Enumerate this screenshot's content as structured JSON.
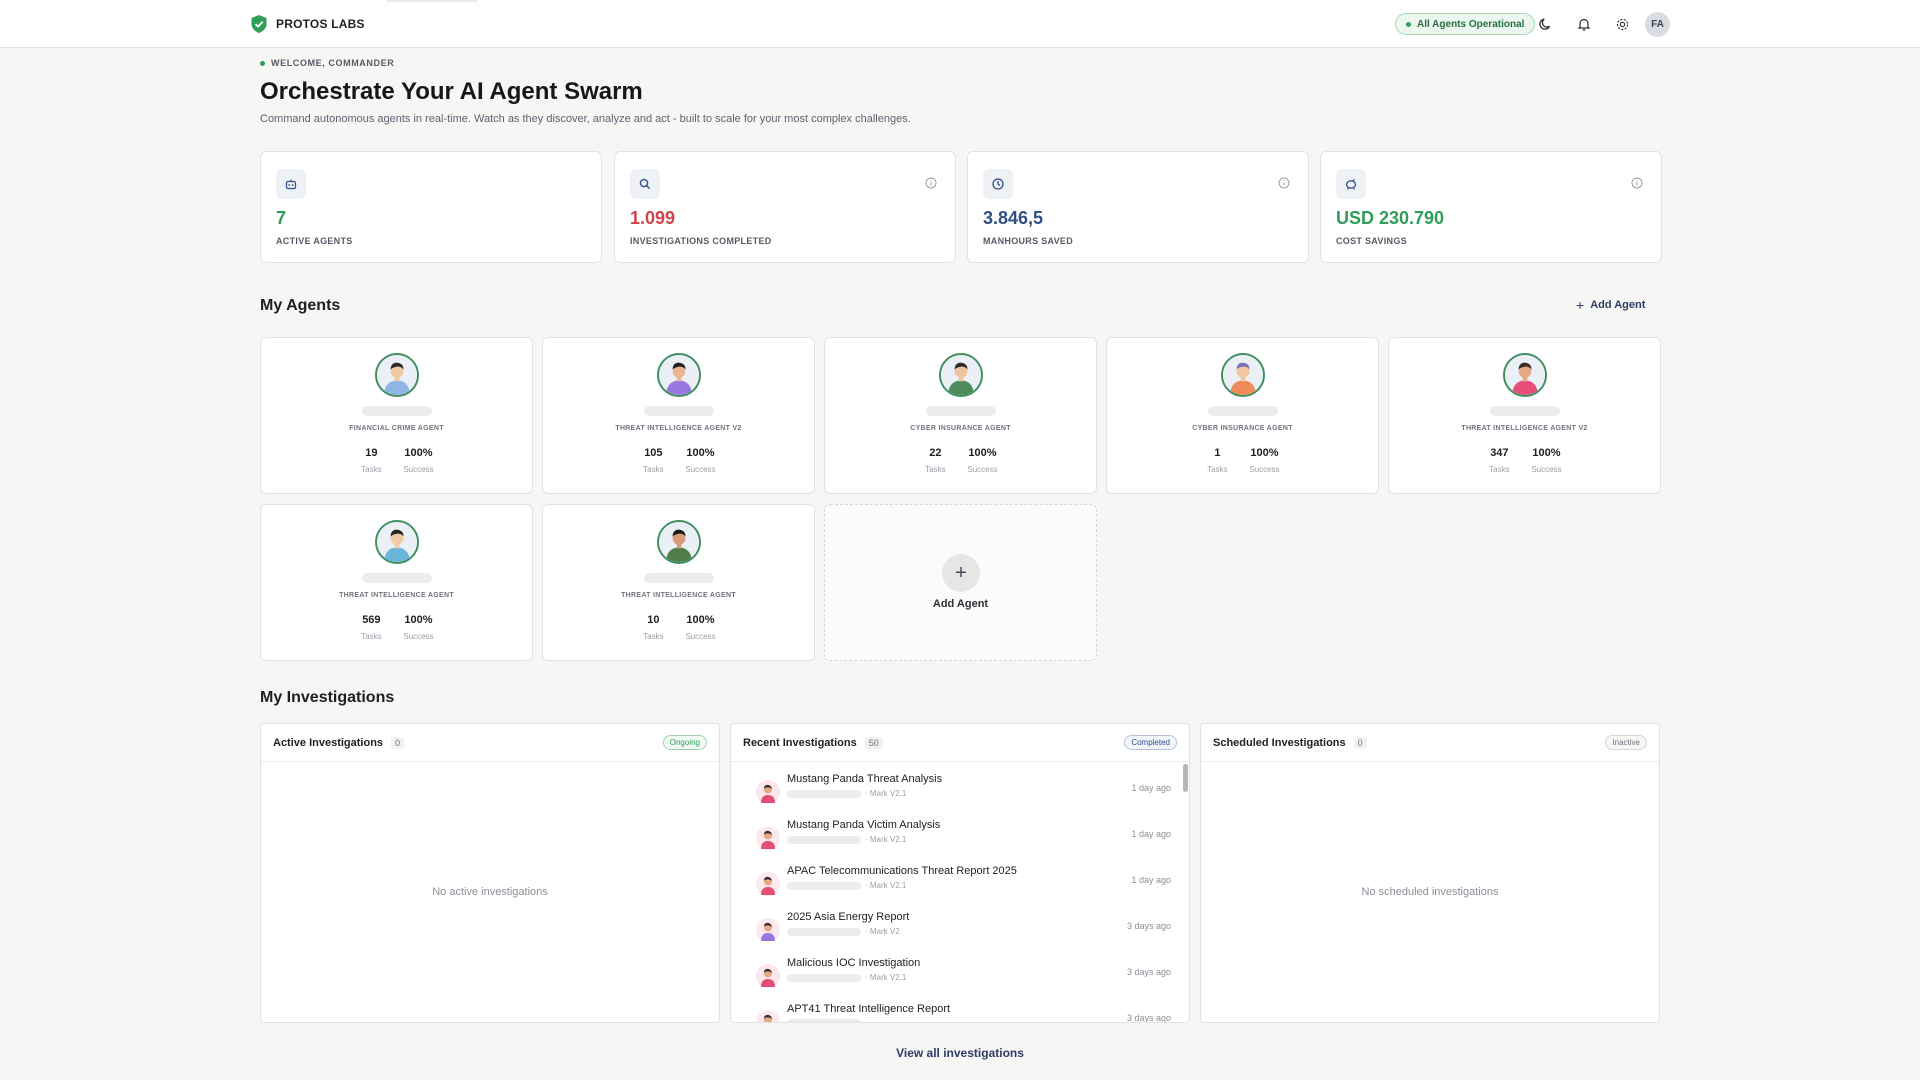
{
  "brand": {
    "name": "PROTOS LABS"
  },
  "topbar": {
    "status": "All Agents Operational",
    "user_initials": "FA"
  },
  "header": {
    "welcome": "WELCOME, COMMANDER",
    "title": "Orchestrate Your AI Agent Swarm",
    "subtitle": "Command autonomous agents in real-time. Watch as they discover, analyze and act - built to scale for your most complex challenges."
  },
  "metrics": [
    {
      "value": "7",
      "label": "ACTIVE AGENTS",
      "color": "#2f9e58",
      "icon": "robot-icon"
    },
    {
      "value": "1.099",
      "label": "INVESTIGATIONS COMPLETED",
      "color": "#d0444b",
      "icon": "search-icon"
    },
    {
      "value": "3.846,5",
      "label": "MANHOURS SAVED",
      "color": "#2f4f86",
      "icon": "clock-icon"
    },
    {
      "value": "USD 230.790",
      "label": "COST SAVINGS",
      "color": "#2f9e58",
      "icon": "piggy-bank-icon"
    }
  ],
  "agents_section": {
    "title": "My Agents",
    "add_label": "Add Agent"
  },
  "agents": [
    {
      "name": "FINANCIAL CRIME AGENT",
      "tasks": "19",
      "success": "100%",
      "tasks_label": "Tasks",
      "success_label": "Success",
      "skin": "#f2c9a5",
      "shirt": "#8fb4e6",
      "hair": "#2b2b2b"
    },
    {
      "name": "THREAT INTELLIGENCE AGENT V2",
      "tasks": "105",
      "success": "100%",
      "tasks_label": "Tasks",
      "success_label": "Success",
      "skin": "#e9b48f",
      "shirt": "#9a76e0",
      "hair": "#1e1e1e"
    },
    {
      "name": "CYBER INSURANCE AGENT",
      "tasks": "22",
      "success": "100%",
      "tasks_label": "Tasks",
      "success_label": "Success",
      "skin": "#f0c29d",
      "shirt": "#4f8a5b",
      "hair": "#2a2a2a"
    },
    {
      "name": "CYBER INSURANCE AGENT",
      "tasks": "1",
      "success": "100%",
      "tasks_label": "Tasks",
      "success_label": "Success",
      "skin": "#f3c6a0",
      "shirt": "#f08a5a",
      "hair": "#7a6fb8"
    },
    {
      "name": "THREAT INTELLIGENCE AGENT V2",
      "tasks": "347",
      "success": "100%",
      "tasks_label": "Tasks",
      "success_label": "Success",
      "skin": "#e7a888",
      "shirt": "#e64d78",
      "hair": "#3a2a2a"
    },
    {
      "name": "THREAT INTELLIGENCE AGENT",
      "tasks": "569",
      "success": "100%",
      "tasks_label": "Tasks",
      "success_label": "Success",
      "skin": "#f2c9a5",
      "shirt": "#69b6d8",
      "hair": "#222222"
    },
    {
      "name": "THREAT INTELLIGENCE AGENT",
      "tasks": "10",
      "success": "100%",
      "tasks_label": "Tasks",
      "success_label": "Success",
      "skin": "#d99c77",
      "shirt": "#4e7d4a",
      "hair": "#1b1b1b"
    }
  ],
  "add_card": {
    "label": "Add Agent"
  },
  "investigations_section": {
    "title": "My Investigations",
    "view_all": "View all investigations"
  },
  "panels": {
    "active": {
      "title": "Active Investigations",
      "count": "0",
      "badge": "Ongoing",
      "empty": "No active investigations"
    },
    "recent": {
      "title": "Recent Investigations",
      "count": "50",
      "badge": "Completed"
    },
    "scheduled": {
      "title": "Scheduled Investigations",
      "count": "0",
      "badge": "Inactive",
      "empty": "No scheduled investigations"
    }
  },
  "recent_items": [
    {
      "title": "Mustang Panda Threat Analysis",
      "agent": "· Mark V2.1",
      "time": "1 day ago",
      "shirt": "#e64d78"
    },
    {
      "title": "Mustang Panda Victim Analysis",
      "agent": "· Mark V2.1",
      "time": "1 day ago",
      "shirt": "#e64d78"
    },
    {
      "title": "APAC Telecommunications Threat Report 2025",
      "agent": "· Mark V2.1",
      "time": "1 day ago",
      "shirt": "#e64d78"
    },
    {
      "title": "2025 Asia Energy Report",
      "agent": "· Mark V2",
      "time": "3 days ago",
      "shirt": "#9a76e0"
    },
    {
      "title": "Malicious IOC Investigation",
      "agent": "· Mark V2.1",
      "time": "3 days ago",
      "shirt": "#e64d78"
    },
    {
      "title": "APT41 Threat Intelligence Report",
      "agent": "",
      "time": "3 days ago",
      "shirt": "#e64d78"
    }
  ]
}
